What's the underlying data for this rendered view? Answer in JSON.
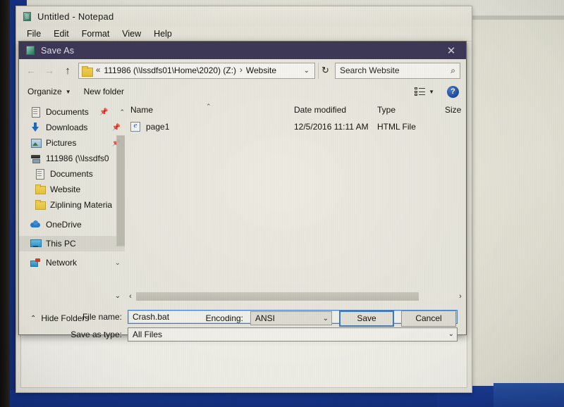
{
  "notepad": {
    "title": "Untitled - Notepad",
    "icon": "notepad-icon",
    "menu": [
      "File",
      "Edit",
      "Format",
      "View",
      "Help"
    ]
  },
  "dialog": {
    "title": "Save As",
    "close_label": "✕",
    "nav": {
      "back": "←",
      "forward": "→",
      "up": "↑",
      "refresh": "↻",
      "dropdown_caret": "⌄"
    },
    "address": {
      "separator_left": "«",
      "crumb_drive": "111986 (\\\\lssdfs01\\Home\\2020) (Z:)",
      "separator": "›",
      "crumb_folder": "Website"
    },
    "search": {
      "placeholder": "Search Website",
      "icon": "⌕"
    },
    "toolbar": {
      "organize": "Organize",
      "organize_caret": "▼",
      "new_folder": "New folder",
      "view_caret": "▼",
      "help": "?"
    },
    "sidebar": {
      "items": [
        {
          "label": "Documents",
          "icon": "document-icon",
          "pin": "📌",
          "chevron": "⌃",
          "selected": false
        },
        {
          "label": "Downloads",
          "icon": "download-icon",
          "pin": "📌",
          "chevron": "",
          "selected": false
        },
        {
          "label": "Pictures",
          "icon": "pictures-icon",
          "pin": "📌",
          "chevron": "",
          "selected": false
        },
        {
          "label": "111986 (\\\\lssdfs0",
          "icon": "network-drive-icon",
          "pin": "",
          "chevron": "",
          "selected": false
        },
        {
          "label": "Documents",
          "icon": "document-icon",
          "pin": "",
          "chevron": "",
          "selected": false
        },
        {
          "label": "Website",
          "icon": "folder-icon",
          "pin": "",
          "chevron": "",
          "selected": false
        },
        {
          "label": "Ziplining Materia",
          "icon": "folder-icon",
          "pin": "",
          "chevron": "",
          "selected": false
        },
        {
          "label": "OneDrive",
          "icon": "cloud-icon",
          "pin": "",
          "chevron": "",
          "selected": false
        },
        {
          "label": "This PC",
          "icon": "this-pc-icon",
          "pin": "",
          "chevron": "",
          "selected": true
        },
        {
          "label": "Network",
          "icon": "network-icon",
          "pin": "",
          "chevron": "⌄",
          "selected": false
        }
      ]
    },
    "filelist": {
      "columns": [
        "Name",
        "Date modified",
        "Type",
        "Size"
      ],
      "sort_caret": "⌃",
      "rows": [
        {
          "name": "page1",
          "icon": "html-file-icon",
          "date": "12/5/2016 11:11 AM",
          "type": "HTML File",
          "size": ""
        }
      ]
    },
    "scroll": {
      "left_arrow": "‹",
      "right_arrow": "›",
      "down_chevron": "⌄"
    },
    "form": {
      "filename_label": "File name:",
      "filename_value": "Crash.bat",
      "savetype_label": "Save as type:",
      "savetype_value": "All Files",
      "chevron": "⌄"
    },
    "actions": {
      "hide_folders": "Hide Folders",
      "hide_folders_caret": "⌃",
      "encoding_label": "Encoding:",
      "encoding_value": "ANSI",
      "encoding_chevron": "⌄",
      "save": "Save",
      "cancel": "Cancel"
    }
  },
  "colors": {
    "titlebar": "#3f3a5a",
    "dialog_bg": "#eeece2",
    "desktop_blue": "#17317f",
    "accent_focus": "#3f7fc4"
  }
}
